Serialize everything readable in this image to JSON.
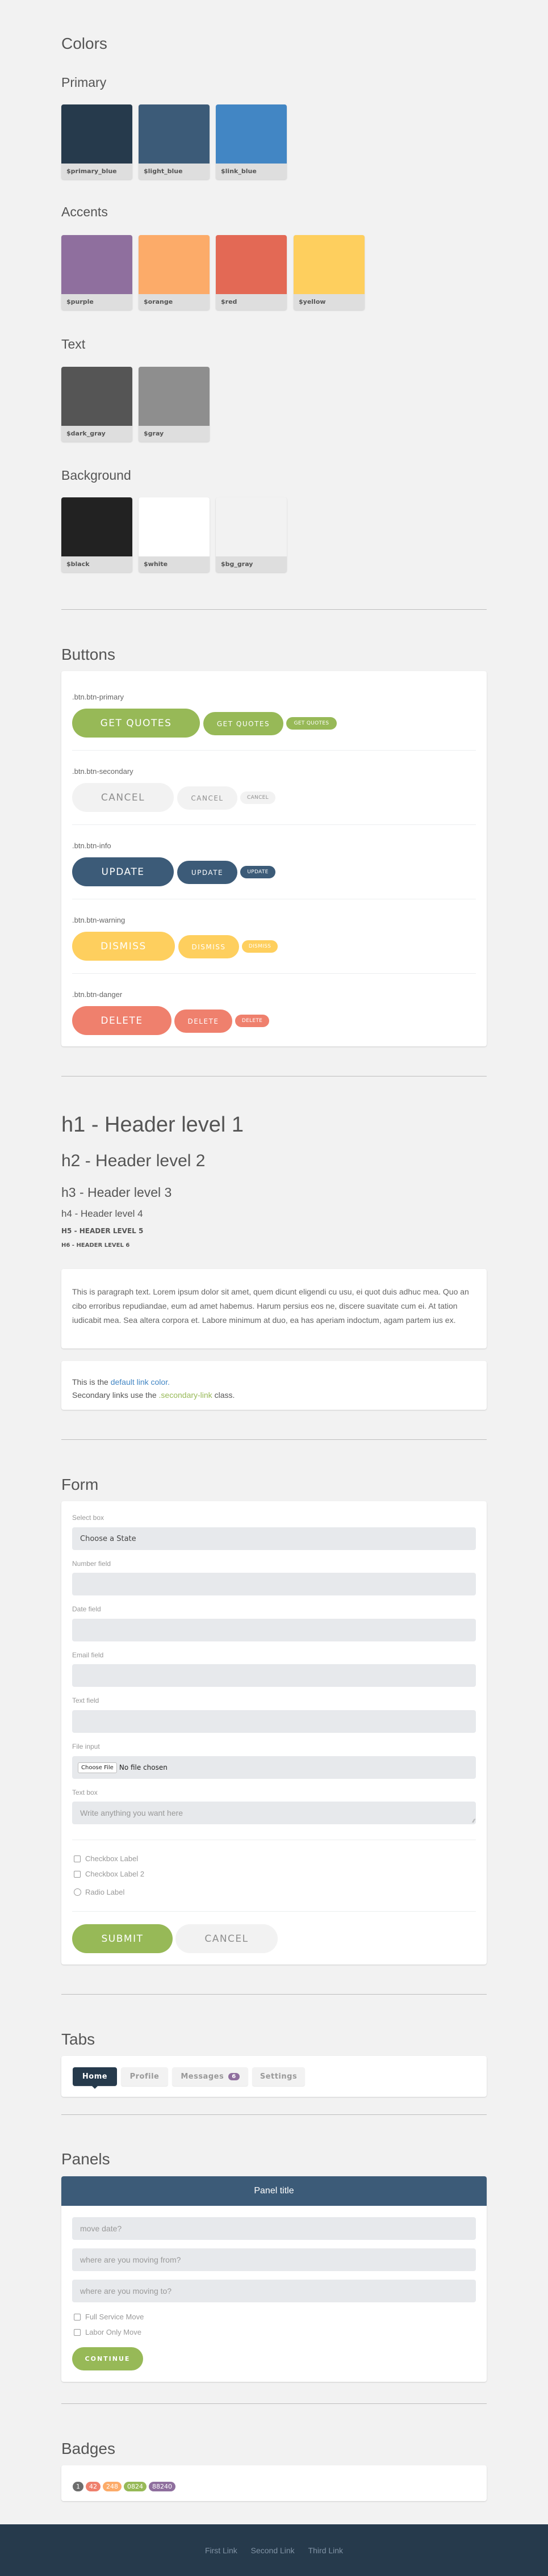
{
  "colors": {
    "title": "Colors",
    "groups": [
      {
        "title": "Primary",
        "swatches": [
          {
            "name": "$primary_blue",
            "hex": "#263a4c"
          },
          {
            "name": "$light_blue",
            "hex": "#3c5b78"
          },
          {
            "name": "$link_blue",
            "hex": "#4286c4"
          }
        ]
      },
      {
        "title": "Accents",
        "swatches": [
          {
            "name": "$purple",
            "hex": "#8f6f9e"
          },
          {
            "name": "$orange",
            "hex": "#fcab69"
          },
          {
            "name": "$red",
            "hex": "#e36955"
          },
          {
            "name": "$yellow",
            "hex": "#fecf5e"
          }
        ]
      },
      {
        "title": "Text",
        "swatches": [
          {
            "name": "$dark_gray",
            "hex": "#555555"
          },
          {
            "name": "$gray",
            "hex": "#8e8e8e"
          }
        ]
      },
      {
        "title": "Background",
        "swatches": [
          {
            "name": "$black",
            "hex": "#222222"
          },
          {
            "name": "$white",
            "hex": "#ffffff"
          },
          {
            "name": "$bg_gray",
            "hex": "#f2f2f2"
          }
        ]
      }
    ]
  },
  "buttons": {
    "title": "Buttons",
    "rows": [
      {
        "class_label": ".btn.btn-primary",
        "label": "Get Quotes",
        "bg": "#97b957",
        "fg": "#ffffff"
      },
      {
        "class_label": ".btn.btn-secondary",
        "label": "Cancel",
        "bg": "#f2f2f2",
        "fg": "#8e8e8e"
      },
      {
        "class_label": ".btn.btn-info",
        "label": "Update",
        "bg": "#3c5b78",
        "fg": "#ffffff"
      },
      {
        "class_label": ".btn.btn-warning",
        "label": "Dismiss",
        "bg": "#fecf5e",
        "fg": "#ffffff"
      },
      {
        "class_label": ".btn.btn-danger",
        "label": "Delete",
        "bg": "#ef806d",
        "fg": "#ffffff"
      }
    ]
  },
  "typography": {
    "h1": "h1 - Header level 1",
    "h2": "h2 - Header level 2",
    "h3": "h3 - Header level 3",
    "h4": "h4 - Header level 4",
    "h5": "H5 - HEADER LEVEL 5",
    "h6": "H6 - HEADER LEVEL 6",
    "paragraph": "This is paragraph text. Lorem ipsum dolor sit amet, quem dicunt eligendi cu usu, ei quot duis adhuc mea. Quo an cibo erroribus repudiandae, eum ad amet habemus. Harum persius eos ne, discere suavitate cum ei. At tation iudicabit mea. Sea altera corpora et. Labore minimum at duo, ea has aperiam indoctum, agam partem ius ex.",
    "links": {
      "line1_prefix": "This is the ",
      "default_link": "default link color.",
      "line2_prefix": "Secondary links use the ",
      "secondary_link": ".secondary-link",
      "line2_suffix": " class."
    }
  },
  "form": {
    "title": "Form",
    "select": {
      "label": "Select box",
      "value": "Choose a State"
    },
    "number": {
      "label": "Number field",
      "value": ""
    },
    "date": {
      "label": "Date field",
      "value": ""
    },
    "email": {
      "label": "Email field",
      "value": ""
    },
    "text": {
      "label": "Text field",
      "value": ""
    },
    "file": {
      "label": "File input",
      "button": "Choose File",
      "status": "No file chosen"
    },
    "textbox": {
      "label": "Text box",
      "placeholder": "Write anything you want here"
    },
    "checkboxes": [
      "Checkbox Label",
      "Checkbox Label 2"
    ],
    "radio": "Radio Label",
    "submit": "Submit",
    "cancel": "Cancel"
  },
  "tabs": {
    "title": "Tabs",
    "items": [
      {
        "label": "Home",
        "active": true
      },
      {
        "label": "Profile",
        "active": false
      },
      {
        "label": "Messages",
        "count": "6",
        "active": false
      },
      {
        "label": "Settings",
        "active": false
      }
    ]
  },
  "panels": {
    "title": "Panels",
    "panel_title": "Panel title",
    "inputs": [
      "move date?",
      "where are you moving from?",
      "where are you moving to?"
    ],
    "checkboxes": [
      "Full Service Move",
      "Labor Only Move"
    ],
    "continue": "Continue"
  },
  "badges": {
    "title": "Badges",
    "items": [
      {
        "value": "1",
        "color": "#6d6d6d"
      },
      {
        "value": "42",
        "color": "#ef806d"
      },
      {
        "value": "248",
        "color": "#fcab69"
      },
      {
        "value": "0824",
        "color": "#97b957"
      },
      {
        "value": "88240",
        "color": "#8f6f9e"
      }
    ]
  },
  "footer": {
    "links": [
      "First Link",
      "Second Link",
      "Third Link"
    ]
  }
}
